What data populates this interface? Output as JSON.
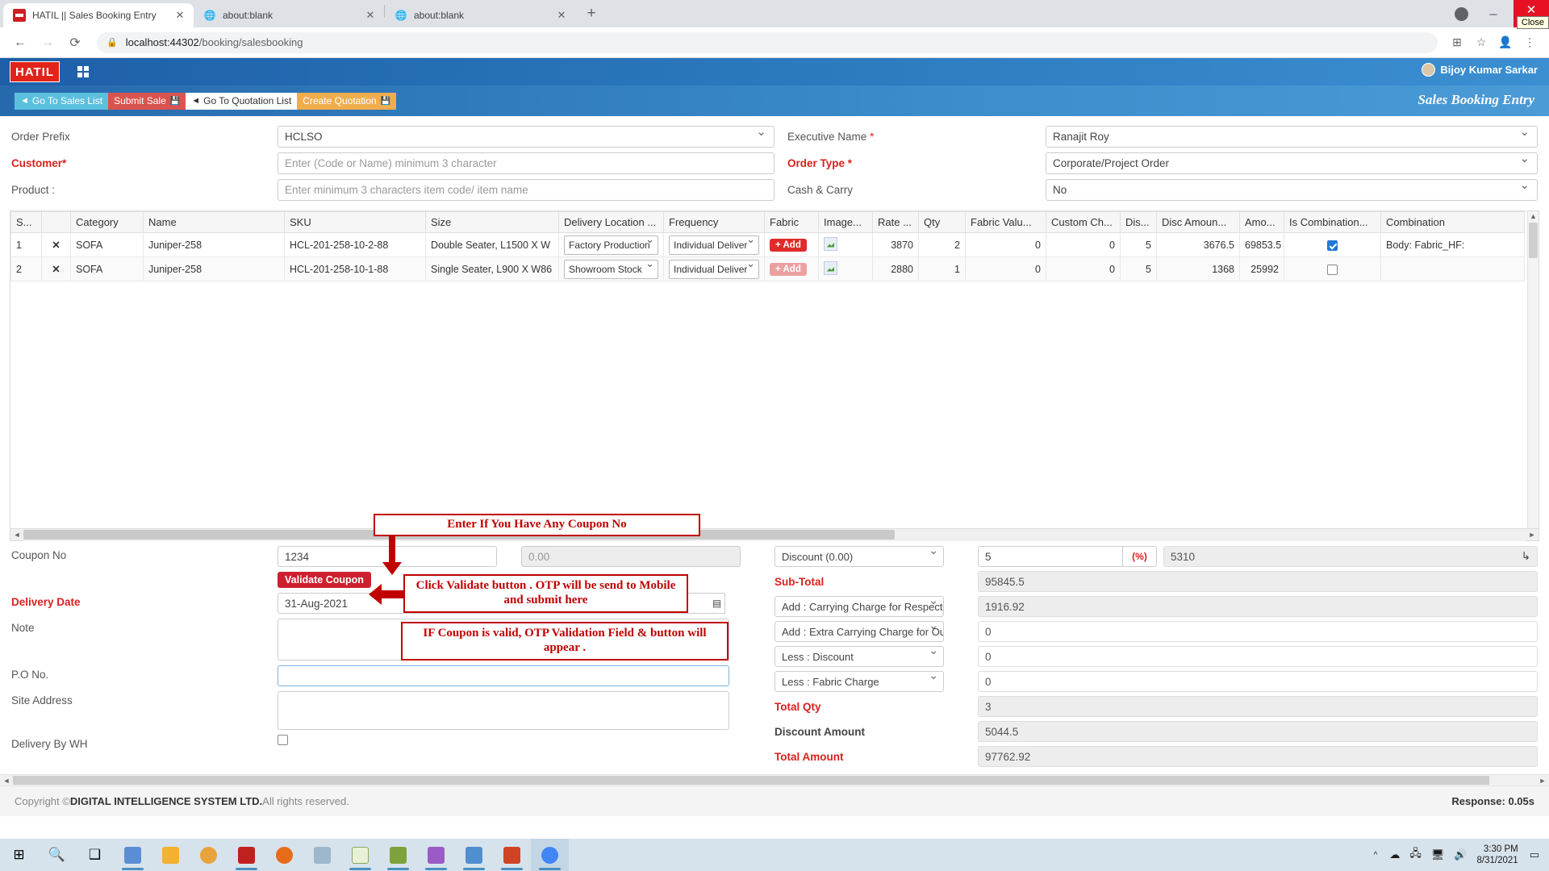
{
  "browser": {
    "tabs": [
      {
        "title": "HATIL || Sales Booking Entry",
        "favicon": "hatil-icon",
        "close": "✕",
        "active": true
      },
      {
        "title": "about:blank",
        "favicon": "globe-icon",
        "close": "✕",
        "active": false
      },
      {
        "title": "about:blank",
        "favicon": "globe-icon",
        "close": "✕",
        "active": false
      }
    ],
    "new_tab": "+",
    "window_controls": {
      "minimize": "─",
      "maximize": "▢",
      "close": "✕",
      "close_tooltip": "Close"
    },
    "nav": {
      "back": "←",
      "forward": "→",
      "reload": "⟳"
    },
    "omnibox": {
      "lock": "🔒",
      "host": "localhost:44302",
      "path": "/booking/salesbooking"
    },
    "toolbar_icons": {
      "split": "⊞",
      "bookmark": "☆",
      "profile": "👤",
      "menu": "⋮"
    }
  },
  "app": {
    "logo": "HATIL",
    "apps_grid_icon": "grid-icon",
    "user": "Bijoy Kumar Sarkar",
    "page_title": "Sales Booking Entry",
    "toolbar": [
      {
        "label": "Go To Sales List",
        "style": "info",
        "left_icon": "◄"
      },
      {
        "label": "Submit Sale",
        "style": "danger",
        "right_icon": "💾"
      },
      {
        "label": "Go To Quotation List",
        "style": "white",
        "left_icon": "◄"
      },
      {
        "label": "Create Quotation",
        "style": "warning",
        "right_icon": "💾"
      }
    ]
  },
  "form_top": {
    "left": [
      {
        "label": "Order Prefix",
        "required": false,
        "value": "HCLSO",
        "type": "select"
      },
      {
        "label": "Customer",
        "required": true,
        "value": "",
        "placeholder": "Enter (Code or Name) minimum 3 character",
        "type": "text"
      },
      {
        "label": "Product :",
        "required": false,
        "value": "",
        "placeholder": "Enter minimum 3 characters item code/ item name",
        "type": "text"
      }
    ],
    "right": [
      {
        "label": "Executive Name",
        "required": true,
        "value": "Ranajit Roy",
        "type": "select"
      },
      {
        "label": "Order Type",
        "required": true,
        "value": "Corporate/Project Order",
        "type": "select"
      },
      {
        "label": "Cash & Carry",
        "required": false,
        "value": "No",
        "type": "select"
      }
    ]
  },
  "grid": {
    "columns": [
      "S...",
      "",
      "Category",
      "Name",
      "SKU",
      "Size",
      "Delivery Location ...",
      "Frequency",
      "Fabric",
      "Image...",
      "Rate ...",
      "Qty",
      "Fabric Valu...",
      "Custom Ch...",
      "Dis...",
      "Disc Amoun...",
      "Amo...",
      "Is Combination...",
      "Combination"
    ],
    "rows": [
      {
        "sl": "1",
        "delete": "✕",
        "category": "SOFA",
        "name": "Juniper-258",
        "sku": "HCL-201-258-10-2-88",
        "size": "Double Seater, L1500 X W",
        "delivery_location": "Factory Production",
        "frequency": "Individual Deliver",
        "fabric": "+ Add",
        "fabric_enabled": true,
        "image": "image-thumb",
        "rate": "3870",
        "qty": "2",
        "fabric_value": "0",
        "custom_charge": "0",
        "discount": "5",
        "disc_amount": "3676.5",
        "amount": "69853.5",
        "is_combination": true,
        "combination": "Body: Fabric_HF:"
      },
      {
        "sl": "2",
        "delete": "✕",
        "category": "SOFA",
        "name": "Juniper-258",
        "sku": "HCL-201-258-10-1-88",
        "size": "Single Seater, L900 X W86",
        "delivery_location": "Showroom Stock",
        "frequency": "Individual Deliver",
        "fabric": "+ Add",
        "fabric_enabled": false,
        "image": "image-thumb",
        "rate": "2880",
        "qty": "1",
        "fabric_value": "0",
        "custom_charge": "0",
        "discount": "5",
        "disc_amount": "1368",
        "amount": "25992",
        "is_combination": false,
        "combination": ""
      }
    ]
  },
  "bottom_left": {
    "coupon_label": "Coupon No",
    "coupon_value": "1234",
    "coupon_extra": "0.00",
    "validate_button": "Validate Coupon",
    "delivery_date_label": "Delivery Date",
    "delivery_date_value": "31-Aug-2021",
    "note_label": "Note",
    "note_value": "",
    "po_label": "P.O No.",
    "po_value": "",
    "site_address_label": "Site Address",
    "site_address_value": "",
    "delivery_by_wh_label": "Delivery By WH",
    "delivery_by_wh_checked": false
  },
  "summary": {
    "rows": [
      {
        "kind": "select",
        "label": "Discount (0.00)",
        "value": "5",
        "pct_badge": "(%)",
        "amount": "5310",
        "tick": "↳"
      },
      {
        "kind": "label",
        "label": "Sub-Total",
        "label_color": "#d9201f",
        "value": "95845.5",
        "readonly": true
      },
      {
        "kind": "select",
        "label": "Add : Carrying Charge for Respective City",
        "value": "1916.92",
        "readonly": true
      },
      {
        "kind": "select",
        "label": "Add : Extra Carrying Charge for Outside of",
        "value": "0",
        "readonly": false
      },
      {
        "kind": "select",
        "label": "Less : Discount",
        "value": "0",
        "readonly": false
      },
      {
        "kind": "select",
        "label": "Less : Fabric Charge",
        "value": "0",
        "readonly": false
      },
      {
        "kind": "label",
        "label": "Total Qty",
        "label_color": "#d9201f",
        "value": "3",
        "readonly": true
      },
      {
        "kind": "label",
        "label": "Discount Amount",
        "label_color": "#444444",
        "value": "5044.5",
        "readonly": true
      },
      {
        "kind": "label",
        "label": "Total Amount",
        "label_color": "#d9201f",
        "value": "97762.92",
        "readonly": true
      }
    ]
  },
  "annotations": [
    {
      "text": "Enter If You Have Any Coupon No"
    },
    {
      "text": "Click Validate button . OTP will be send to Mobile and submit here"
    },
    {
      "text": "IF Coupon is valid, OTP Validation Field & button will appear ."
    }
  ],
  "footer": {
    "copyright_prefix": "Copyright ©",
    "company": "DIGITAL INTELLIGENCE SYSTEM LTD.",
    "rights": " All rights reserved.",
    "response": "Response: 0.05s"
  },
  "taskbar": {
    "start": "⊞",
    "search": "🔍",
    "taskview": "❑",
    "apps": [
      "sql-server-icon",
      "file-explorer-icon",
      "chrome-canary-icon",
      "filezilla-icon",
      "firefox-icon",
      "calculator-icon",
      "editor-icon",
      "sql-dev-icon",
      "visual-studio-icon",
      "ssms-icon",
      "powerpoint-icon",
      "chrome-icon"
    ],
    "tray": {
      "chevron": "^",
      "network": "🖧",
      "volume": "🔊",
      "time": "3:30 PM",
      "date": "8/31/2021"
    }
  }
}
